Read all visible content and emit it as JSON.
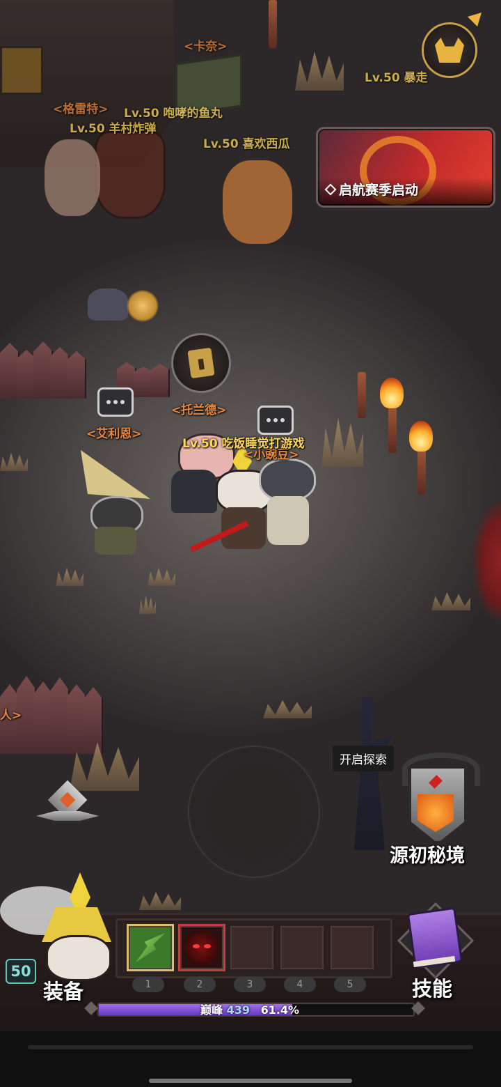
{
  "event_banner": {
    "label": "启航赛季启动",
    "icon": "diamond-marker-icon"
  },
  "top_right": {
    "pet_icon": "dog-head-icon",
    "arrow_icon": "triangle-arrow-icon"
  },
  "npcs": {
    "kanai": "<卡奈>",
    "gelite": "<格雷特>",
    "tuolande": "<托兰德>",
    "ailien": "<艾利恩>",
    "xiaowandou": "<小豌豆>",
    "offscreen_left": "人>"
  },
  "players": {
    "p1": "Lv.50 咆哮的鱼丸",
    "p2": "Lv.50 羊村炸弹",
    "p3": "Lv.50 喜欢西瓜",
    "p4": "Lv.50 暴走",
    "self": "Lv.50 吃饭睡觉打游戏"
  },
  "quest_icon": "card-quest-icon",
  "explore": {
    "tooltip": "开启探索",
    "portal_label": "源初秘境",
    "portal_icon": "horned-skull-shield-icon"
  },
  "joystick_icon": "diamond-compass-icon",
  "hud": {
    "level": "50",
    "equip_label": "装备",
    "skill_label": "技能",
    "skill_book_icon": "spell-book-icon",
    "avatar_icon": "samurai-helmet-avatar-icon",
    "slots": [
      {
        "num": "1",
        "icon": "green-arrow-skill-icon"
      },
      {
        "num": "2",
        "icon": "red-eyes-skill-icon"
      },
      {
        "num": "3",
        "icon": ""
      },
      {
        "num": "4",
        "icon": ""
      },
      {
        "num": "5",
        "icon": ""
      }
    ],
    "xp": {
      "tier": "巅峰",
      "value": "439",
      "percent_label": "61.4%",
      "fraction": 0.614
    }
  },
  "colors": {
    "npc_name": "#e8873f",
    "player_name": "#ffd95a",
    "xp_bar": "#8a52d6",
    "gold": "#c9a04a"
  }
}
